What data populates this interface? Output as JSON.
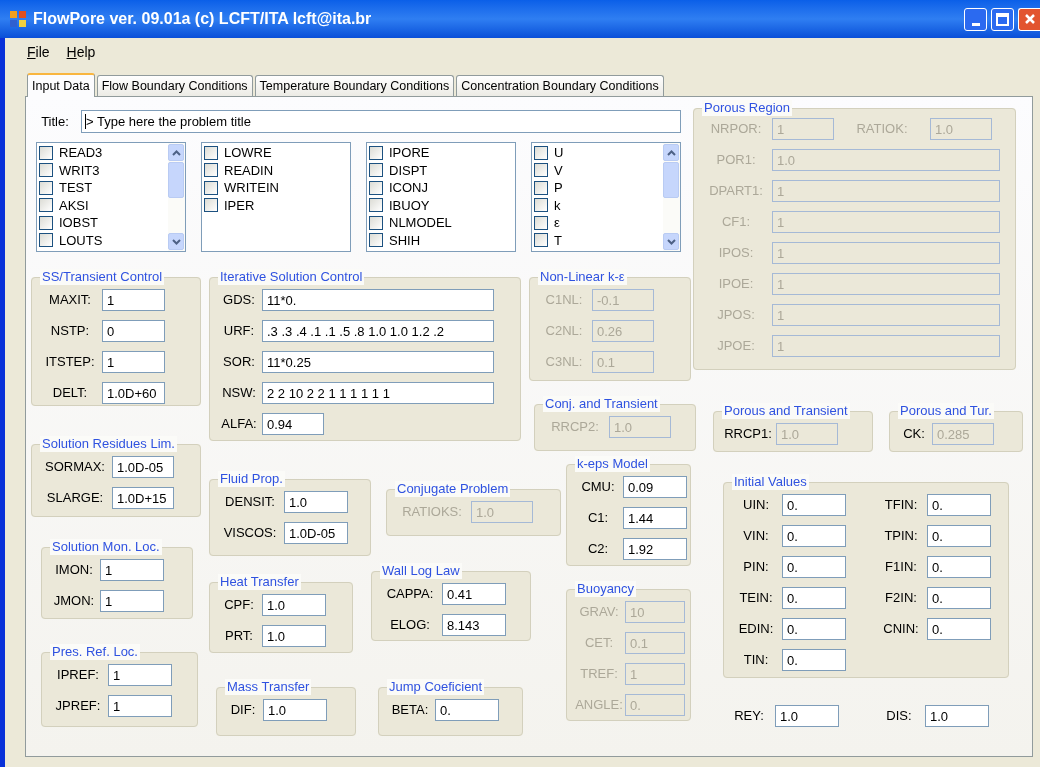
{
  "window": {
    "title": "FlowPore ver. 09.01a (c) LCFT/ITA lcft@ita.br"
  },
  "menu": [
    {
      "label": "File"
    },
    {
      "label": "Help"
    }
  ],
  "tabs": [
    {
      "label": "Input Data",
      "selected": true
    },
    {
      "label": "Flow Boundary Conditions",
      "selected": false
    },
    {
      "label": "Temperature Boundary Conditions",
      "selected": false
    },
    {
      "label": "Concentration Boundary Conditions",
      "selected": false
    }
  ],
  "title_field": {
    "label": "Title:",
    "value": "> Type here the problem title"
  },
  "lists": [
    {
      "scrollbar": true,
      "items": [
        {
          "label": "READ3",
          "checked": false
        },
        {
          "label": "WRIT3",
          "checked": false
        },
        {
          "label": "TEST",
          "checked": false
        },
        {
          "label": "AKSI",
          "checked": false
        },
        {
          "label": "IOBST",
          "checked": false
        },
        {
          "label": "LOUTS",
          "checked": false
        }
      ]
    },
    {
      "scrollbar": false,
      "items": [
        {
          "label": "LOWRE",
          "checked": false
        },
        {
          "label": "READIN",
          "checked": false
        },
        {
          "label": "WRITEIN",
          "checked": false
        },
        {
          "label": "IPER",
          "checked": false
        }
      ]
    },
    {
      "scrollbar": false,
      "items": [
        {
          "label": "IPORE",
          "checked": false
        },
        {
          "label": "DISPT",
          "checked": false
        },
        {
          "label": "ICONJ",
          "checked": false
        },
        {
          "label": "IBUOY",
          "checked": false
        },
        {
          "label": "NLMODEL",
          "checked": false
        },
        {
          "label": "SHIH",
          "checked": false
        }
      ]
    },
    {
      "scrollbar": true,
      "items": [
        {
          "label": "U",
          "checked": false
        },
        {
          "label": "V",
          "checked": false
        },
        {
          "label": "P",
          "checked": false
        },
        {
          "label": "k",
          "checked": false
        },
        {
          "label": "ε",
          "checked": false
        },
        {
          "label": "T",
          "checked": false
        }
      ]
    }
  ],
  "groups": [
    {
      "title": "SS/Transient Control",
      "fields": [
        {
          "label": "MAXIT:",
          "value": "1",
          "disabled": false
        },
        {
          "label": "NSTP:",
          "value": "0",
          "disabled": false
        },
        {
          "label": "ITSTEP:",
          "value": "1",
          "disabled": false
        },
        {
          "label": "DELT:",
          "value": "1.0D+60",
          "disabled": false
        }
      ]
    },
    {
      "title": "Solution Residues Lim.",
      "fields": [
        {
          "label": "SORMAX:",
          "value": "1.0D-05",
          "disabled": false
        },
        {
          "label": "SLARGE:",
          "value": "1.0D+15",
          "disabled": false
        }
      ]
    },
    {
      "title": "Solution Mon. Loc.",
      "fields": [
        {
          "label": "IMON:",
          "value": "1",
          "disabled": false
        },
        {
          "label": "JMON:",
          "value": "1",
          "disabled": false
        }
      ]
    },
    {
      "title": "Pres. Ref. Loc.",
      "fields": [
        {
          "label": "IPREF:",
          "value": "1",
          "disabled": false
        },
        {
          "label": "JPREF:",
          "value": "1",
          "disabled": false
        }
      ]
    },
    {
      "title": "Iterative Solution Control",
      "fields": [
        {
          "label": "GDS:",
          "value": "11*0.",
          "disabled": false
        },
        {
          "label": "URF:",
          "value": ".3 .3 .4 .1 .1 .5 .8 1.0 1.0 1.2 .2",
          "disabled": false
        },
        {
          "label": "SOR:",
          "value": "11*0.25",
          "disabled": false
        },
        {
          "label": "NSW:",
          "value": "2 2 10 2 2 1 1 1 1 1 1",
          "disabled": false
        },
        {
          "label": "ALFA:",
          "value": "0.94",
          "disabled": false
        }
      ]
    },
    {
      "title": "Non-Linear k-ε",
      "fields": [
        {
          "label": "C1NL:",
          "value": "-0.1",
          "disabled": true
        },
        {
          "label": "C2NL:",
          "value": "0.26",
          "disabled": true
        },
        {
          "label": "C3NL:",
          "value": "0.1",
          "disabled": true
        }
      ]
    },
    {
      "title": "Conj. and Transient",
      "fields": [
        {
          "label": "RRCP2:",
          "value": "1.0",
          "disabled": true
        }
      ]
    },
    {
      "title": "Fluid Prop.",
      "fields": [
        {
          "label": "DENSIT:",
          "value": "1.0",
          "disabled": false
        },
        {
          "label": "VISCOS:",
          "value": "1.0D-05",
          "disabled": false
        }
      ]
    },
    {
      "title": "Heat Transfer",
      "fields": [
        {
          "label": "CPF:",
          "value": "1.0",
          "disabled": false
        },
        {
          "label": "PRT:",
          "value": "1.0",
          "disabled": false
        }
      ]
    },
    {
      "title": "Mass Transfer",
      "fields": [
        {
          "label": "DIF:",
          "value": "1.0",
          "disabled": false
        }
      ]
    },
    {
      "title": "Conjugate Problem",
      "fields": [
        {
          "label": "RATIOKS:",
          "value": "1.0",
          "disabled": true
        }
      ]
    },
    {
      "title": "Wall Log Law",
      "fields": [
        {
          "label": "CAPPA:",
          "value": "0.41",
          "disabled": false
        },
        {
          "label": "ELOG:",
          "value": "8.143",
          "disabled": false
        }
      ]
    },
    {
      "title": "Jump Coeficient",
      "fields": [
        {
          "label": "BETA:",
          "value": "0.",
          "disabled": false
        }
      ]
    },
    {
      "title": "k-eps Model",
      "fields": [
        {
          "label": "CMU:",
          "value": "0.09",
          "disabled": false
        },
        {
          "label": "C1:",
          "value": "1.44",
          "disabled": false
        },
        {
          "label": "C2:",
          "value": "1.92",
          "disabled": false
        }
      ]
    },
    {
      "title": "Buoyancy",
      "fields": [
        {
          "label": "GRAV:",
          "value": "10",
          "disabled": true
        },
        {
          "label": "CET:",
          "value": "0.1",
          "disabled": true
        },
        {
          "label": "TREF:",
          "value": "1",
          "disabled": true
        },
        {
          "label": "ANGLE:",
          "value": "0.",
          "disabled": true
        }
      ]
    },
    {
      "title": "Porous Region",
      "fields": [
        {
          "label": "NRPOR:",
          "value": "1",
          "disabled": true
        },
        {
          "label": "RATIOK:",
          "value": "1.0",
          "disabled": true
        },
        {
          "label": "POR1:",
          "value": "1.0",
          "disabled": true
        },
        {
          "label": "DPART1:",
          "value": "1",
          "disabled": true
        },
        {
          "label": "CF1:",
          "value": "1",
          "disabled": true
        },
        {
          "label": "IPOS:",
          "value": "1",
          "disabled": true
        },
        {
          "label": "IPOE:",
          "value": "1",
          "disabled": true
        },
        {
          "label": "JPOS:",
          "value": "1",
          "disabled": true
        },
        {
          "label": "JPOE:",
          "value": "1",
          "disabled": true
        }
      ]
    },
    {
      "title": "Porous and Transient",
      "fields": [
        {
          "label": "RRCP1:",
          "value": "1.0",
          "disabled": false,
          "read_only": true
        }
      ]
    },
    {
      "title": "Porous and Tur.",
      "fields": [
        {
          "label": "CK:",
          "value": "0.285",
          "disabled": false,
          "read_only": true
        }
      ]
    },
    {
      "title": "Initial Values",
      "fields": [
        {
          "label": "UIN:",
          "value": "0.",
          "disabled": false
        },
        {
          "label": "TFIN:",
          "value": "0.",
          "disabled": false
        },
        {
          "label": "VIN:",
          "value": "0.",
          "disabled": false
        },
        {
          "label": "TPIN:",
          "value": "0.",
          "disabled": false
        },
        {
          "label": "PIN:",
          "value": "0.",
          "disabled": false
        },
        {
          "label": "F1IN:",
          "value": "0.",
          "disabled": false
        },
        {
          "label": "TEIN:",
          "value": "0.",
          "disabled": false
        },
        {
          "label": "F2IN:",
          "value": "0.",
          "disabled": false
        },
        {
          "label": "EDIN:",
          "value": "0.",
          "disabled": false
        },
        {
          "label": "CNIN:",
          "value": "0.",
          "disabled": false
        },
        {
          "label": "TIN:",
          "value": "0.",
          "disabled": false
        }
      ]
    }
  ],
  "bottom_fields": [
    {
      "label": "REY:",
      "value": "1.0",
      "disabled": false
    },
    {
      "label": "DIS:",
      "value": "1.0",
      "disabled": false
    }
  ]
}
